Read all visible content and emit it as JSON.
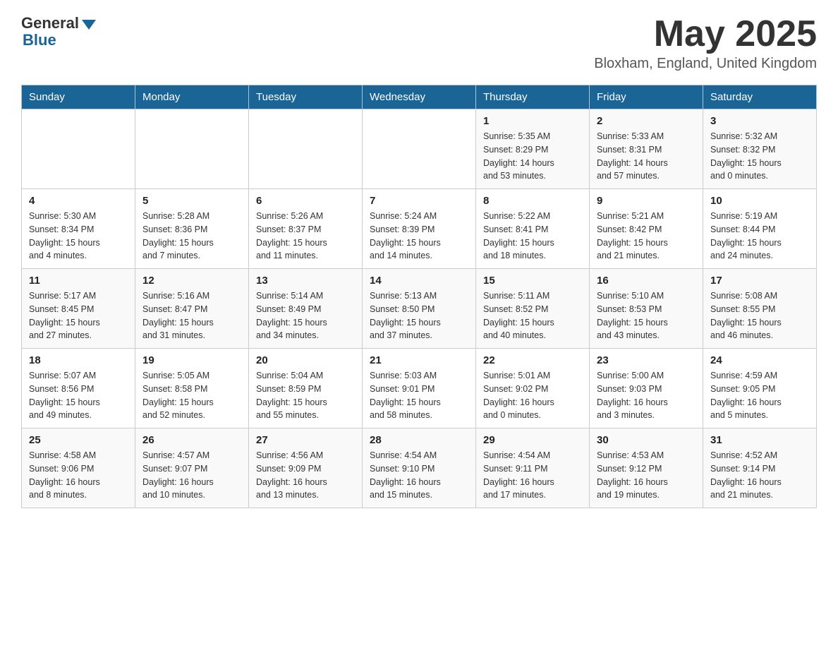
{
  "logo": {
    "general": "General",
    "blue": "Blue",
    "arrow": "▼"
  },
  "header": {
    "month_year": "May 2025",
    "location": "Bloxham, England, United Kingdom"
  },
  "days_of_week": [
    "Sunday",
    "Monday",
    "Tuesday",
    "Wednesday",
    "Thursday",
    "Friday",
    "Saturday"
  ],
  "weeks": [
    [
      {
        "num": "",
        "info": ""
      },
      {
        "num": "",
        "info": ""
      },
      {
        "num": "",
        "info": ""
      },
      {
        "num": "",
        "info": ""
      },
      {
        "num": "1",
        "info": "Sunrise: 5:35 AM\nSunset: 8:29 PM\nDaylight: 14 hours\nand 53 minutes."
      },
      {
        "num": "2",
        "info": "Sunrise: 5:33 AM\nSunset: 8:31 PM\nDaylight: 14 hours\nand 57 minutes."
      },
      {
        "num": "3",
        "info": "Sunrise: 5:32 AM\nSunset: 8:32 PM\nDaylight: 15 hours\nand 0 minutes."
      }
    ],
    [
      {
        "num": "4",
        "info": "Sunrise: 5:30 AM\nSunset: 8:34 PM\nDaylight: 15 hours\nand 4 minutes."
      },
      {
        "num": "5",
        "info": "Sunrise: 5:28 AM\nSunset: 8:36 PM\nDaylight: 15 hours\nand 7 minutes."
      },
      {
        "num": "6",
        "info": "Sunrise: 5:26 AM\nSunset: 8:37 PM\nDaylight: 15 hours\nand 11 minutes."
      },
      {
        "num": "7",
        "info": "Sunrise: 5:24 AM\nSunset: 8:39 PM\nDaylight: 15 hours\nand 14 minutes."
      },
      {
        "num": "8",
        "info": "Sunrise: 5:22 AM\nSunset: 8:41 PM\nDaylight: 15 hours\nand 18 minutes."
      },
      {
        "num": "9",
        "info": "Sunrise: 5:21 AM\nSunset: 8:42 PM\nDaylight: 15 hours\nand 21 minutes."
      },
      {
        "num": "10",
        "info": "Sunrise: 5:19 AM\nSunset: 8:44 PM\nDaylight: 15 hours\nand 24 minutes."
      }
    ],
    [
      {
        "num": "11",
        "info": "Sunrise: 5:17 AM\nSunset: 8:45 PM\nDaylight: 15 hours\nand 27 minutes."
      },
      {
        "num": "12",
        "info": "Sunrise: 5:16 AM\nSunset: 8:47 PM\nDaylight: 15 hours\nand 31 minutes."
      },
      {
        "num": "13",
        "info": "Sunrise: 5:14 AM\nSunset: 8:49 PM\nDaylight: 15 hours\nand 34 minutes."
      },
      {
        "num": "14",
        "info": "Sunrise: 5:13 AM\nSunset: 8:50 PM\nDaylight: 15 hours\nand 37 minutes."
      },
      {
        "num": "15",
        "info": "Sunrise: 5:11 AM\nSunset: 8:52 PM\nDaylight: 15 hours\nand 40 minutes."
      },
      {
        "num": "16",
        "info": "Sunrise: 5:10 AM\nSunset: 8:53 PM\nDaylight: 15 hours\nand 43 minutes."
      },
      {
        "num": "17",
        "info": "Sunrise: 5:08 AM\nSunset: 8:55 PM\nDaylight: 15 hours\nand 46 minutes."
      }
    ],
    [
      {
        "num": "18",
        "info": "Sunrise: 5:07 AM\nSunset: 8:56 PM\nDaylight: 15 hours\nand 49 minutes."
      },
      {
        "num": "19",
        "info": "Sunrise: 5:05 AM\nSunset: 8:58 PM\nDaylight: 15 hours\nand 52 minutes."
      },
      {
        "num": "20",
        "info": "Sunrise: 5:04 AM\nSunset: 8:59 PM\nDaylight: 15 hours\nand 55 minutes."
      },
      {
        "num": "21",
        "info": "Sunrise: 5:03 AM\nSunset: 9:01 PM\nDaylight: 15 hours\nand 58 minutes."
      },
      {
        "num": "22",
        "info": "Sunrise: 5:01 AM\nSunset: 9:02 PM\nDaylight: 16 hours\nand 0 minutes."
      },
      {
        "num": "23",
        "info": "Sunrise: 5:00 AM\nSunset: 9:03 PM\nDaylight: 16 hours\nand 3 minutes."
      },
      {
        "num": "24",
        "info": "Sunrise: 4:59 AM\nSunset: 9:05 PM\nDaylight: 16 hours\nand 5 minutes."
      }
    ],
    [
      {
        "num": "25",
        "info": "Sunrise: 4:58 AM\nSunset: 9:06 PM\nDaylight: 16 hours\nand 8 minutes."
      },
      {
        "num": "26",
        "info": "Sunrise: 4:57 AM\nSunset: 9:07 PM\nDaylight: 16 hours\nand 10 minutes."
      },
      {
        "num": "27",
        "info": "Sunrise: 4:56 AM\nSunset: 9:09 PM\nDaylight: 16 hours\nand 13 minutes."
      },
      {
        "num": "28",
        "info": "Sunrise: 4:54 AM\nSunset: 9:10 PM\nDaylight: 16 hours\nand 15 minutes."
      },
      {
        "num": "29",
        "info": "Sunrise: 4:54 AM\nSunset: 9:11 PM\nDaylight: 16 hours\nand 17 minutes."
      },
      {
        "num": "30",
        "info": "Sunrise: 4:53 AM\nSunset: 9:12 PM\nDaylight: 16 hours\nand 19 minutes."
      },
      {
        "num": "31",
        "info": "Sunrise: 4:52 AM\nSunset: 9:14 PM\nDaylight: 16 hours\nand 21 minutes."
      }
    ]
  ]
}
